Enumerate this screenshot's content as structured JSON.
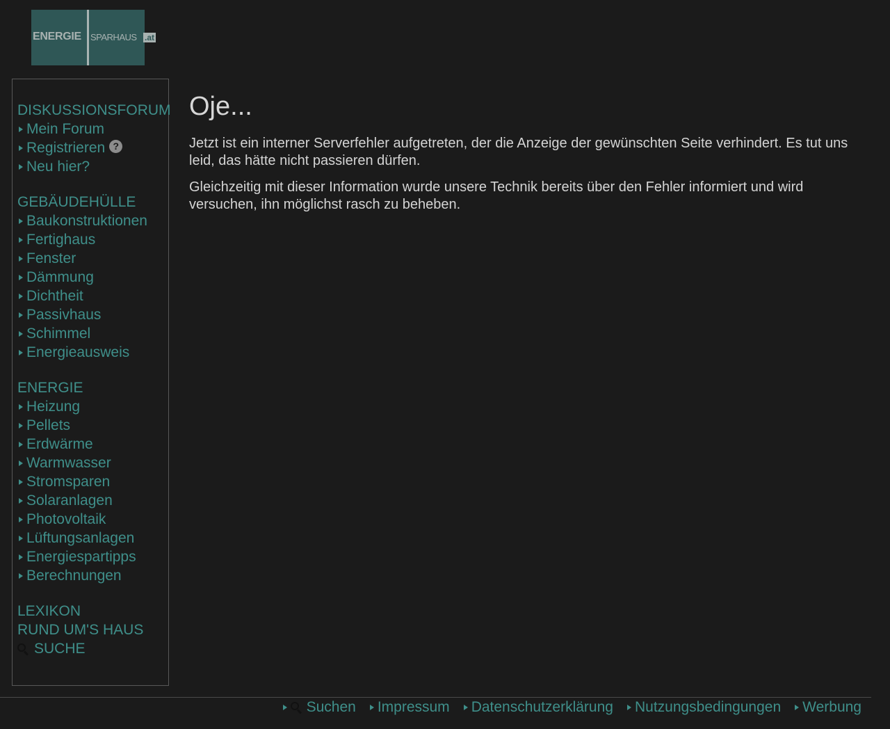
{
  "logo": {
    "word1": "ENERGIE",
    "word2": "SPARHAUS",
    "word3": ".at"
  },
  "sidebar": {
    "sections": [
      {
        "title": "DISKUSSIONSFORUM",
        "items": [
          "Mein Forum",
          "Registrieren",
          "Neu hier?"
        ]
      },
      {
        "title": "GEBÄUDEHÜLLE",
        "items": [
          "Baukonstruktionen",
          "Fertighaus",
          "Fenster",
          "Dämmung",
          "Dichtheit",
          "Passivhaus",
          "Schimmel",
          "Energieausweis"
        ]
      },
      {
        "title": "ENERGIE",
        "items": [
          "Heizung",
          "Pellets",
          "Erdwärme",
          "Warmwasser",
          "Stromsparen",
          "Solaranlagen",
          "Photovoltaik",
          "Lüftungsanlagen",
          "Energiespartipps",
          "Berechnungen"
        ]
      }
    ],
    "lexikon": "LEXIKON",
    "rund": "RUND UM'S HAUS",
    "suche": "SUCHE",
    "help_icon": "?"
  },
  "main": {
    "title": "Oje...",
    "para1": "Jetzt ist ein interner Serverfehler aufgetreten, der die Anzeige der gewünschten Seite verhindert. Es tut uns leid, das hätte nicht passieren dürfen.",
    "para2": "Gleichzeitig mit dieser Information wurde unsere Technik bereits über den Fehler informiert und wird versuchen, ihn möglichst rasch zu beheben."
  },
  "footer": {
    "links": [
      "Suchen",
      "Impressum",
      "Datenschutzerklärung",
      "Nutzungsbedingungen",
      "Werbung"
    ]
  },
  "colors": {
    "accent": "#3f8f8a",
    "background": "#1b1b1b",
    "logo_bg": "#2f5756",
    "text": "#d4d4d4"
  }
}
